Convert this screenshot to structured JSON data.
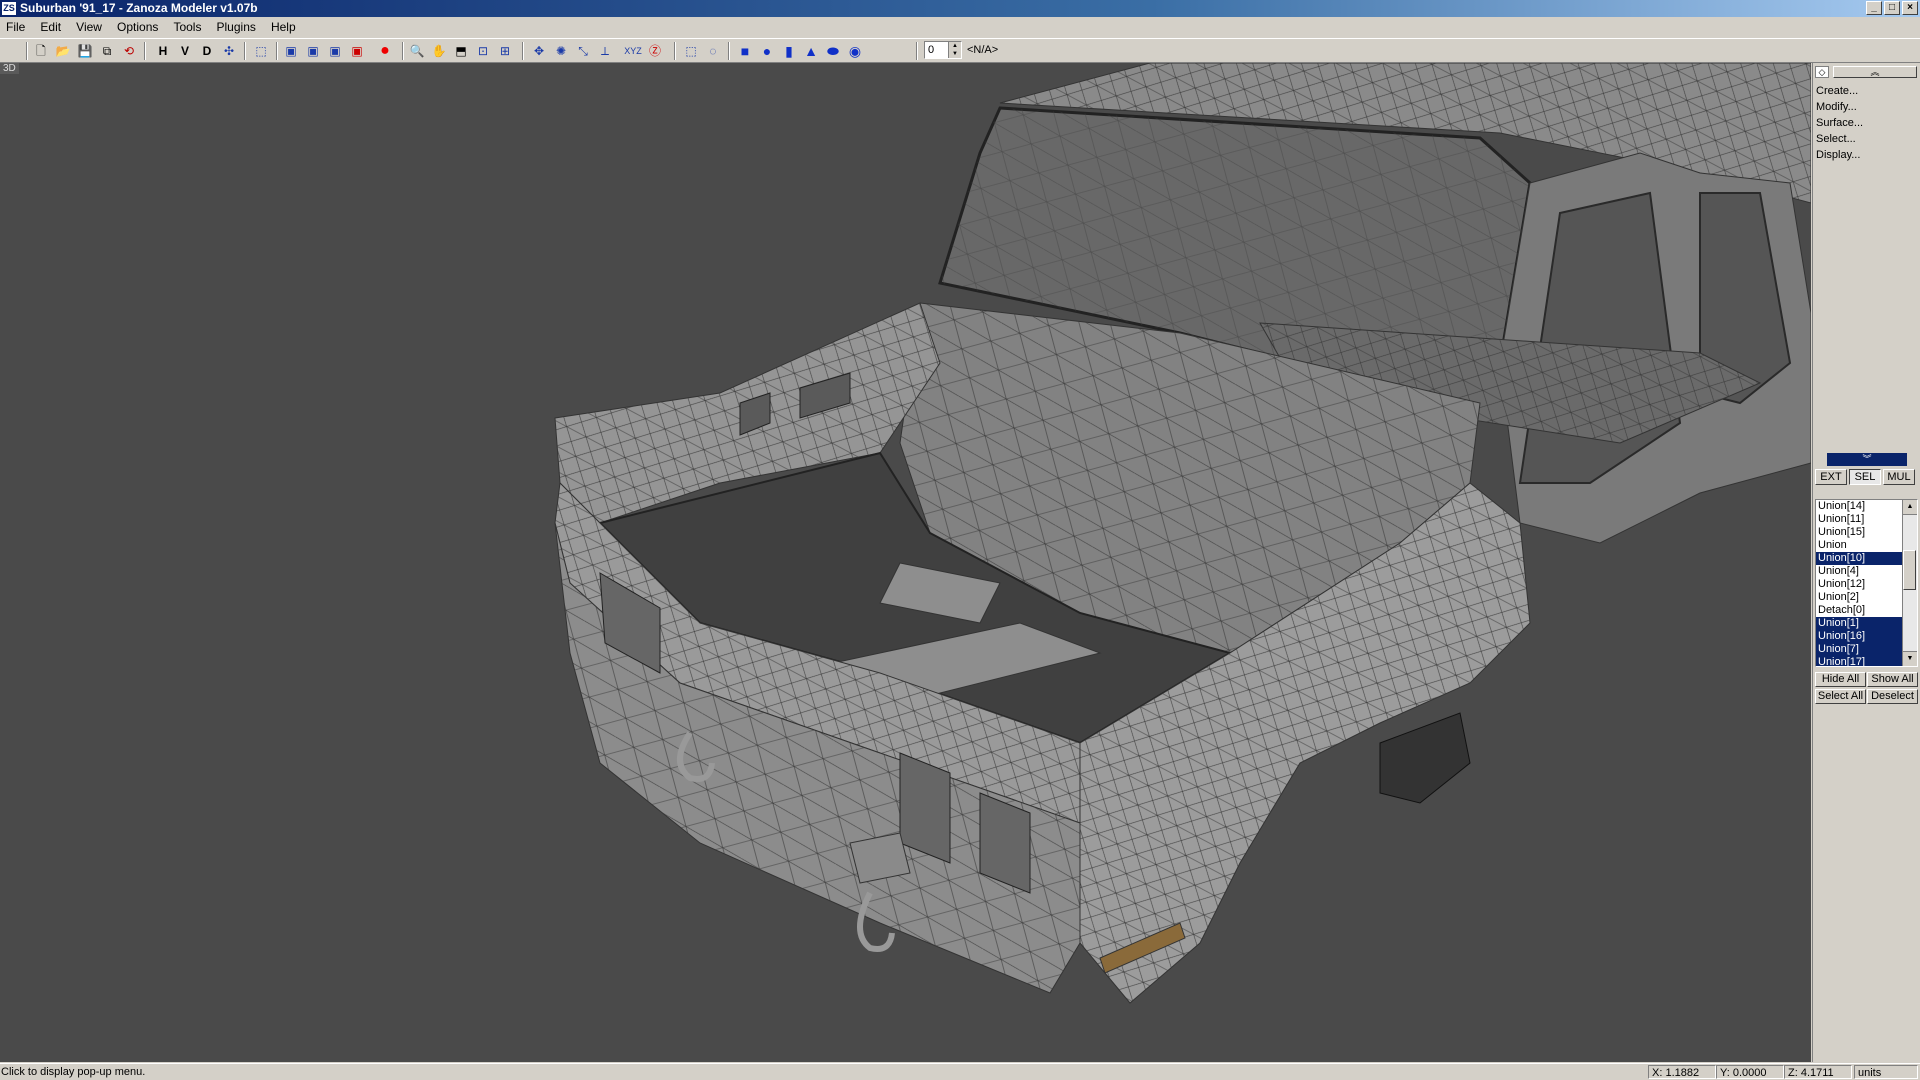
{
  "window": {
    "title": "Suburban '91_17 - Zanoza Modeler v1.07b",
    "icon": "ZS"
  },
  "menu": [
    "File",
    "Edit",
    "View",
    "Options",
    "Tools",
    "Plugins",
    "Help"
  ],
  "toolbar": {
    "view_letters": [
      "H",
      "V",
      "D"
    ],
    "spin_value": "0",
    "selection_field": "<N/A>"
  },
  "viewport": {
    "label": "3D",
    "background": "#4a4a4a"
  },
  "side_panel": {
    "menu": [
      "Create...",
      "Modify...",
      "Surface...",
      "Select...",
      "Display..."
    ],
    "tabs": [
      "EXT",
      "SEL",
      "MUL"
    ],
    "active_tab": "SEL",
    "objects": [
      {
        "name": "Union[14]",
        "selected": false
      },
      {
        "name": "Union[11]",
        "selected": false
      },
      {
        "name": "Union[15]",
        "selected": false
      },
      {
        "name": "Union",
        "selected": false
      },
      {
        "name": "Union[10]",
        "selected": true
      },
      {
        "name": "Union[4]",
        "selected": false
      },
      {
        "name": "Union[12]",
        "selected": false
      },
      {
        "name": "Union[2]",
        "selected": false
      },
      {
        "name": "Detach[0]",
        "selected": false
      },
      {
        "name": "Union[1]",
        "selected": true
      },
      {
        "name": "Union[16]",
        "selected": true
      },
      {
        "name": "Union[7]",
        "selected": true
      },
      {
        "name": "Union[17]",
        "selected": true
      }
    ],
    "buttons": {
      "hide_all": "Hide All",
      "show_all": "Show All",
      "select_all": "Select All",
      "deselect": "Deselect"
    }
  },
  "status": {
    "message": "Click to display pop-up menu.",
    "x": "X: 1.1882",
    "y": "Y: 0.0000",
    "z": "Z: 4.1711",
    "units": "units"
  }
}
